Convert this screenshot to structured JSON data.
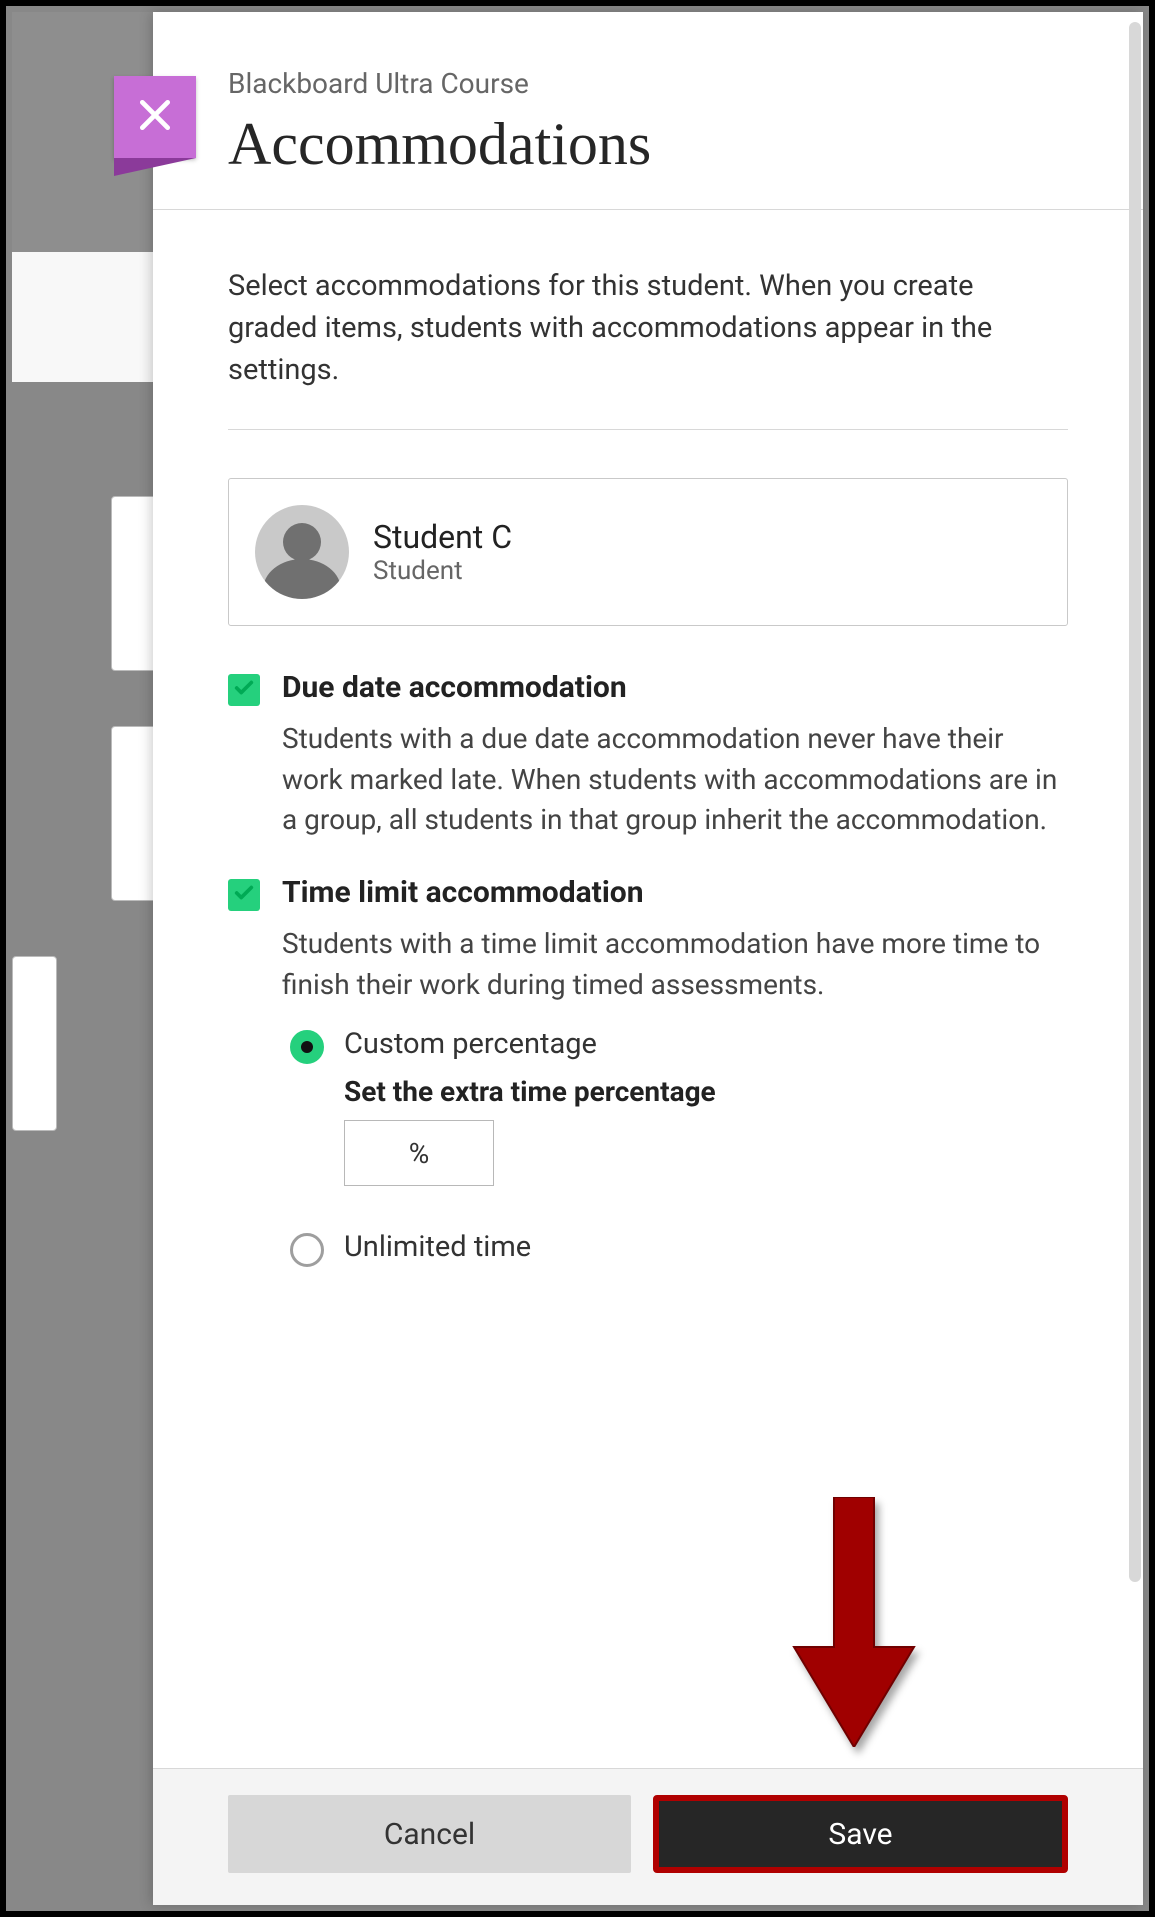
{
  "header": {
    "breadcrumb": "Blackboard Ultra Course",
    "title": "Accommodations"
  },
  "intro": "Select accommodations for this student. When you create graded items, students with accommodations appear in the settings.",
  "student": {
    "name": "Student C",
    "role": "Student"
  },
  "due_date": {
    "title": "Due date accommodation",
    "desc": "Students with a due date accommodation never have their work marked late. When students with accommodations are in a group, all students in that group inherit the accommodation.",
    "checked": true
  },
  "time_limit": {
    "title": "Time limit accommodation",
    "desc": "Students with a time limit accommodation have more time to finish their work during timed assessments.",
    "checked": true,
    "options": {
      "custom": {
        "label": "Custom percentage",
        "sublabel": "Set the extra time percentage",
        "unit": "%",
        "selected": true
      },
      "unlimited": {
        "label": "Unlimited time",
        "selected": false
      }
    }
  },
  "footer": {
    "cancel": "Cancel",
    "save": "Save"
  }
}
